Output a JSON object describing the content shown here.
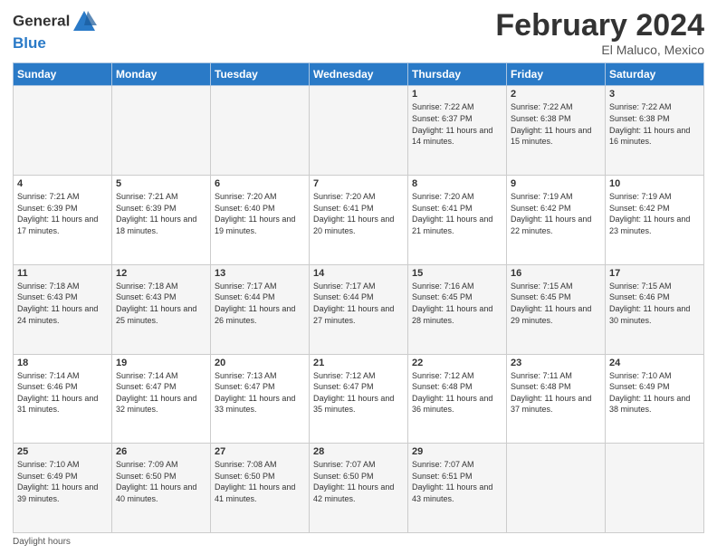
{
  "header": {
    "logo_text_general": "General",
    "logo_text_blue": "Blue",
    "month_title": "February 2024",
    "location": "El Maluco, Mexico"
  },
  "footer": {
    "note": "Daylight hours"
  },
  "calendar": {
    "days_of_week": [
      "Sunday",
      "Monday",
      "Tuesday",
      "Wednesday",
      "Thursday",
      "Friday",
      "Saturday"
    ],
    "weeks": [
      [
        {
          "day": "",
          "sunrise": "",
          "sunset": "",
          "daylight": ""
        },
        {
          "day": "",
          "sunrise": "",
          "sunset": "",
          "daylight": ""
        },
        {
          "day": "",
          "sunrise": "",
          "sunset": "",
          "daylight": ""
        },
        {
          "day": "",
          "sunrise": "",
          "sunset": "",
          "daylight": ""
        },
        {
          "day": "1",
          "sunrise": "7:22 AM",
          "sunset": "6:37 PM",
          "daylight": "11 hours and 14 minutes."
        },
        {
          "day": "2",
          "sunrise": "7:22 AM",
          "sunset": "6:38 PM",
          "daylight": "11 hours and 15 minutes."
        },
        {
          "day": "3",
          "sunrise": "7:22 AM",
          "sunset": "6:38 PM",
          "daylight": "11 hours and 16 minutes."
        }
      ],
      [
        {
          "day": "4",
          "sunrise": "7:21 AM",
          "sunset": "6:39 PM",
          "daylight": "11 hours and 17 minutes."
        },
        {
          "day": "5",
          "sunrise": "7:21 AM",
          "sunset": "6:39 PM",
          "daylight": "11 hours and 18 minutes."
        },
        {
          "day": "6",
          "sunrise": "7:20 AM",
          "sunset": "6:40 PM",
          "daylight": "11 hours and 19 minutes."
        },
        {
          "day": "7",
          "sunrise": "7:20 AM",
          "sunset": "6:41 PM",
          "daylight": "11 hours and 20 minutes."
        },
        {
          "day": "8",
          "sunrise": "7:20 AM",
          "sunset": "6:41 PM",
          "daylight": "11 hours and 21 minutes."
        },
        {
          "day": "9",
          "sunrise": "7:19 AM",
          "sunset": "6:42 PM",
          "daylight": "11 hours and 22 minutes."
        },
        {
          "day": "10",
          "sunrise": "7:19 AM",
          "sunset": "6:42 PM",
          "daylight": "11 hours and 23 minutes."
        }
      ],
      [
        {
          "day": "11",
          "sunrise": "7:18 AM",
          "sunset": "6:43 PM",
          "daylight": "11 hours and 24 minutes."
        },
        {
          "day": "12",
          "sunrise": "7:18 AM",
          "sunset": "6:43 PM",
          "daylight": "11 hours and 25 minutes."
        },
        {
          "day": "13",
          "sunrise": "7:17 AM",
          "sunset": "6:44 PM",
          "daylight": "11 hours and 26 minutes."
        },
        {
          "day": "14",
          "sunrise": "7:17 AM",
          "sunset": "6:44 PM",
          "daylight": "11 hours and 27 minutes."
        },
        {
          "day": "15",
          "sunrise": "7:16 AM",
          "sunset": "6:45 PM",
          "daylight": "11 hours and 28 minutes."
        },
        {
          "day": "16",
          "sunrise": "7:15 AM",
          "sunset": "6:45 PM",
          "daylight": "11 hours and 29 minutes."
        },
        {
          "day": "17",
          "sunrise": "7:15 AM",
          "sunset": "6:46 PM",
          "daylight": "11 hours and 30 minutes."
        }
      ],
      [
        {
          "day": "18",
          "sunrise": "7:14 AM",
          "sunset": "6:46 PM",
          "daylight": "11 hours and 31 minutes."
        },
        {
          "day": "19",
          "sunrise": "7:14 AM",
          "sunset": "6:47 PM",
          "daylight": "11 hours and 32 minutes."
        },
        {
          "day": "20",
          "sunrise": "7:13 AM",
          "sunset": "6:47 PM",
          "daylight": "11 hours and 33 minutes."
        },
        {
          "day": "21",
          "sunrise": "7:12 AM",
          "sunset": "6:47 PM",
          "daylight": "11 hours and 35 minutes."
        },
        {
          "day": "22",
          "sunrise": "7:12 AM",
          "sunset": "6:48 PM",
          "daylight": "11 hours and 36 minutes."
        },
        {
          "day": "23",
          "sunrise": "7:11 AM",
          "sunset": "6:48 PM",
          "daylight": "11 hours and 37 minutes."
        },
        {
          "day": "24",
          "sunrise": "7:10 AM",
          "sunset": "6:49 PM",
          "daylight": "11 hours and 38 minutes."
        }
      ],
      [
        {
          "day": "25",
          "sunrise": "7:10 AM",
          "sunset": "6:49 PM",
          "daylight": "11 hours and 39 minutes."
        },
        {
          "day": "26",
          "sunrise": "7:09 AM",
          "sunset": "6:50 PM",
          "daylight": "11 hours and 40 minutes."
        },
        {
          "day": "27",
          "sunrise": "7:08 AM",
          "sunset": "6:50 PM",
          "daylight": "11 hours and 41 minutes."
        },
        {
          "day": "28",
          "sunrise": "7:07 AM",
          "sunset": "6:50 PM",
          "daylight": "11 hours and 42 minutes."
        },
        {
          "day": "29",
          "sunrise": "7:07 AM",
          "sunset": "6:51 PM",
          "daylight": "11 hours and 43 minutes."
        },
        {
          "day": "",
          "sunrise": "",
          "sunset": "",
          "daylight": ""
        },
        {
          "day": "",
          "sunrise": "",
          "sunset": "",
          "daylight": ""
        }
      ]
    ]
  }
}
